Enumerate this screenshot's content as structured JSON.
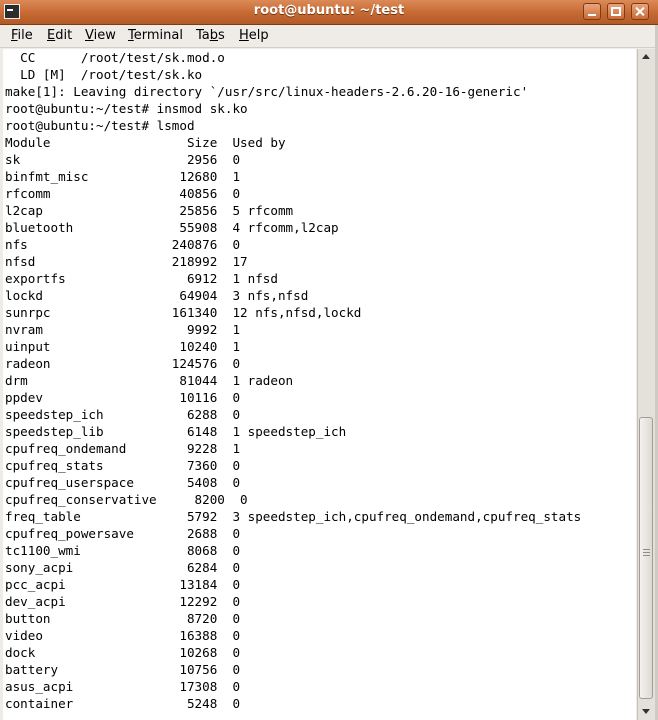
{
  "window": {
    "title": "root@ubuntu: ~/test"
  },
  "menu": [
    {
      "label": "File",
      "mnemonic": "F",
      "rest": "ile"
    },
    {
      "label": "Edit",
      "mnemonic": "E",
      "rest": "dit"
    },
    {
      "label": "View",
      "mnemonic": "V",
      "rest": "iew"
    },
    {
      "label": "Terminal",
      "mnemonic": "T",
      "rest": "erminal"
    },
    {
      "label": "Tabs",
      "pre": "Ta",
      "mnemonic": "b",
      "rest": "s"
    },
    {
      "label": "Help",
      "mnemonic": "H",
      "rest": "elp"
    }
  ],
  "terminal": {
    "lines": [
      "  CC      /root/test/sk.mod.o",
      "  LD [M]  /root/test/sk.ko",
      "make[1]: Leaving directory `/usr/src/linux-headers-2.6.20-16-generic'",
      "root@ubuntu:~/test# insmod sk.ko",
      "root@ubuntu:~/test# lsmod",
      "Module                  Size  Used by",
      "sk                      2956  0",
      "binfmt_misc            12680  1",
      "rfcomm                 40856  0",
      "l2cap                  25856  5 rfcomm",
      "bluetooth              55908  4 rfcomm,l2cap",
      "nfs                   240876  0",
      "nfsd                  218992  17",
      "exportfs                6912  1 nfsd",
      "lockd                  64904  3 nfs,nfsd",
      "sunrpc                161340  12 nfs,nfsd,lockd",
      "nvram                   9992  1",
      "uinput                 10240  1",
      "radeon                124576  0",
      "drm                    81044  1 radeon",
      "ppdev                  10116  0",
      "speedstep_ich           6288  0",
      "speedstep_lib           6148  1 speedstep_ich",
      "cpufreq_ondemand        9228  1",
      "cpufreq_stats           7360  0",
      "cpufreq_userspace       5408  0",
      "cpufreq_conservative     8200  0",
      "freq_table              5792  3 speedstep_ich,cpufreq_ondemand,cpufreq_stats",
      "cpufreq_powersave       2688  0",
      "tc1100_wmi              8068  0",
      "sony_acpi               6284  0",
      "pcc_acpi               13184  0",
      "dev_acpi               12292  0",
      "button                  8720  0",
      "video                  16388  0",
      "dock                   10268  0",
      "battery                10756  0",
      "asus_acpi              17308  0",
      "container               5248  0"
    ]
  }
}
